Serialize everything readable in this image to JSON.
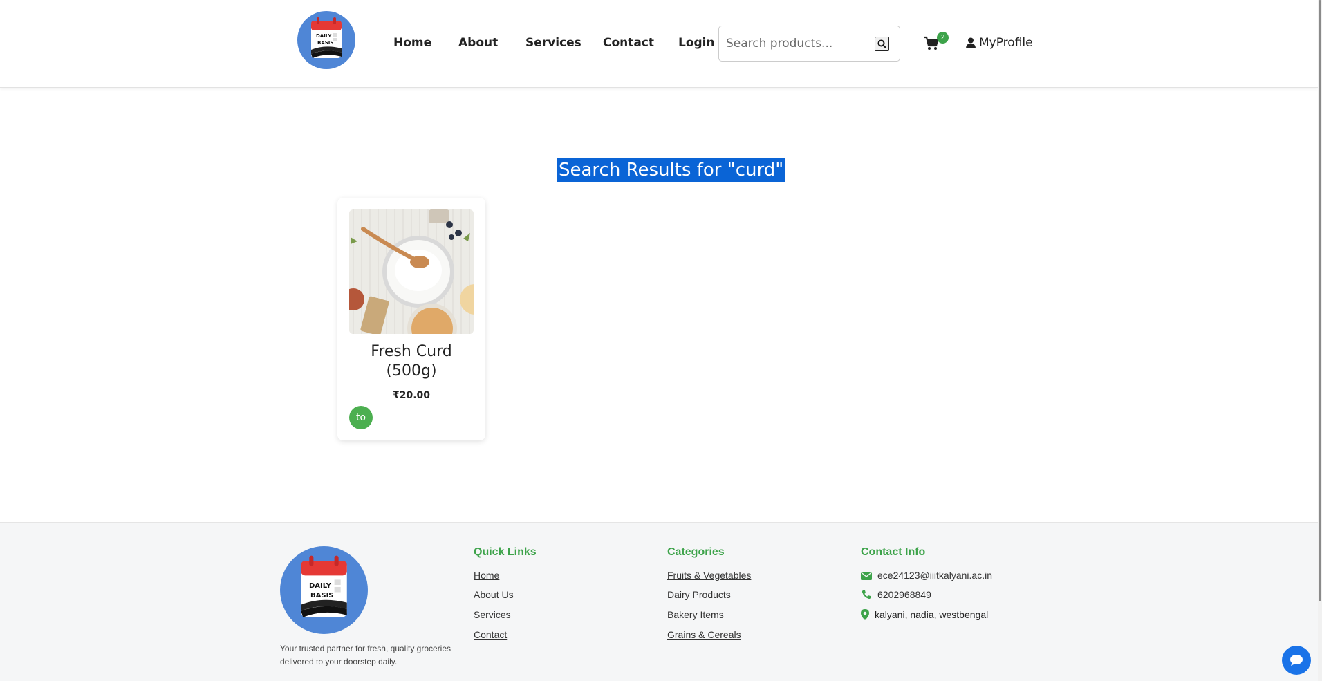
{
  "header": {
    "logo_text": [
      "DAILY",
      "BASIS"
    ],
    "nav": [
      {
        "label": "Home"
      },
      {
        "label": "About"
      },
      {
        "label": "Services"
      },
      {
        "label": "Contact"
      },
      {
        "label": "Login"
      }
    ],
    "search": {
      "placeholder": "Search products...",
      "value": ""
    },
    "cart_count": "2",
    "profile_label": "MyProfile"
  },
  "main": {
    "results_title": "Search Results for \"curd\"",
    "products": [
      {
        "name": "Fresh Curd (500g)",
        "price": "₹20.00",
        "button_label": "to"
      }
    ]
  },
  "footer": {
    "tagline": "Your trusted partner for fresh, quality groceries delivered to your doorstep daily.",
    "quick_links": {
      "title": "Quick Links",
      "items": [
        "Home",
        "About Us",
        "Services",
        "Contact"
      ]
    },
    "categories": {
      "title": "Categories",
      "items": [
        "Fruits & Vegetables",
        "Dairy Products",
        "Bakery Items",
        "Grains & Cereals"
      ]
    },
    "contact": {
      "title": "Contact Info",
      "email": "ece24123@iiitkalyani.ac.in",
      "phone": "6202968849",
      "address": "kalyani, nadia, westbengal"
    }
  },
  "colors": {
    "accent_green": "#3da34a",
    "highlight_blue": "#0a64d6",
    "logo_blue": "#4f86d6"
  },
  "icons": [
    "search-icon",
    "cart-icon",
    "user-icon",
    "envelope-icon",
    "phone-icon",
    "map-pin-icon",
    "chat-icon"
  ]
}
